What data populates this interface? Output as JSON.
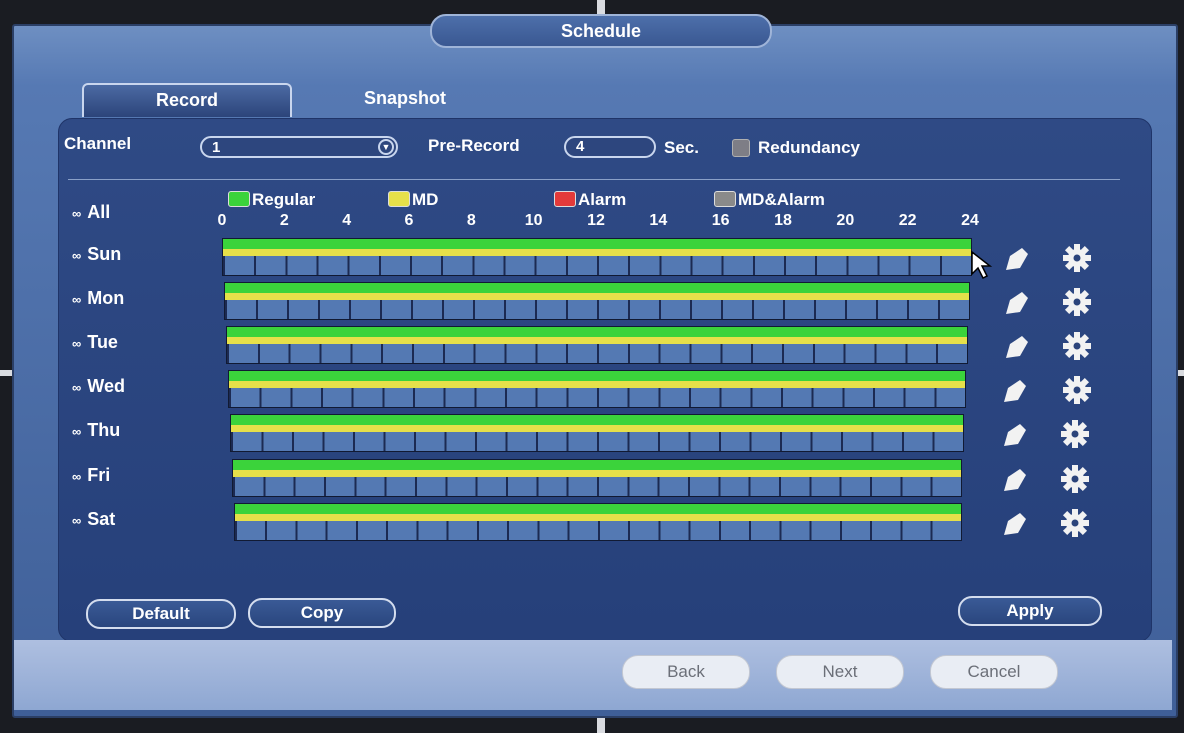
{
  "window": {
    "title": "Schedule"
  },
  "tabs": [
    {
      "label": "Record",
      "active": true
    },
    {
      "label": "Snapshot",
      "active": false
    }
  ],
  "settings": {
    "channel_label": "Channel",
    "channel_value": "1",
    "pre_record_label": "Pre-Record",
    "pre_record_value": "4",
    "pre_record_unit": "Sec.",
    "redundancy_label": "Redundancy",
    "redundancy_checked": false
  },
  "legend": [
    {
      "label": "Regular",
      "color": "#3bd33b"
    },
    {
      "label": "MD",
      "color": "#e6e04a"
    },
    {
      "label": "Alarm",
      "color": "#e33a3a"
    },
    {
      "label": "MD&Alarm",
      "color": "#8a8a8a"
    }
  ],
  "timeline": {
    "ticks": [
      "0",
      "2",
      "4",
      "6",
      "8",
      "10",
      "12",
      "14",
      "16",
      "18",
      "20",
      "22",
      "24"
    ]
  },
  "schedule": {
    "all_label": "All",
    "days": [
      {
        "label": "Sun",
        "regular": [
          0,
          24
        ],
        "md": [
          0,
          24
        ]
      },
      {
        "label": "Mon",
        "regular": [
          0,
          24
        ],
        "md": [
          0,
          24
        ]
      },
      {
        "label": "Tue",
        "regular": [
          0,
          24
        ],
        "md": [
          0,
          24
        ]
      },
      {
        "label": "Wed",
        "regular": [
          0,
          24
        ],
        "md": [
          0,
          24
        ]
      },
      {
        "label": "Thu",
        "regular": [
          0,
          24
        ],
        "md": [
          0,
          24
        ]
      },
      {
        "label": "Fri",
        "regular": [
          0,
          24
        ],
        "md": [
          0,
          24
        ]
      },
      {
        "label": "Sat",
        "regular": [
          0,
          24
        ],
        "md": [
          0,
          24
        ]
      }
    ]
  },
  "buttons": {
    "default_label": "Default",
    "copy_label": "Copy",
    "apply_label": "Apply",
    "back_label": "Back",
    "next_label": "Next",
    "cancel_label": "Cancel"
  },
  "icons": {
    "edit": "pencil-icon",
    "settings": "gear-icon",
    "link": "chain-link-icon"
  }
}
